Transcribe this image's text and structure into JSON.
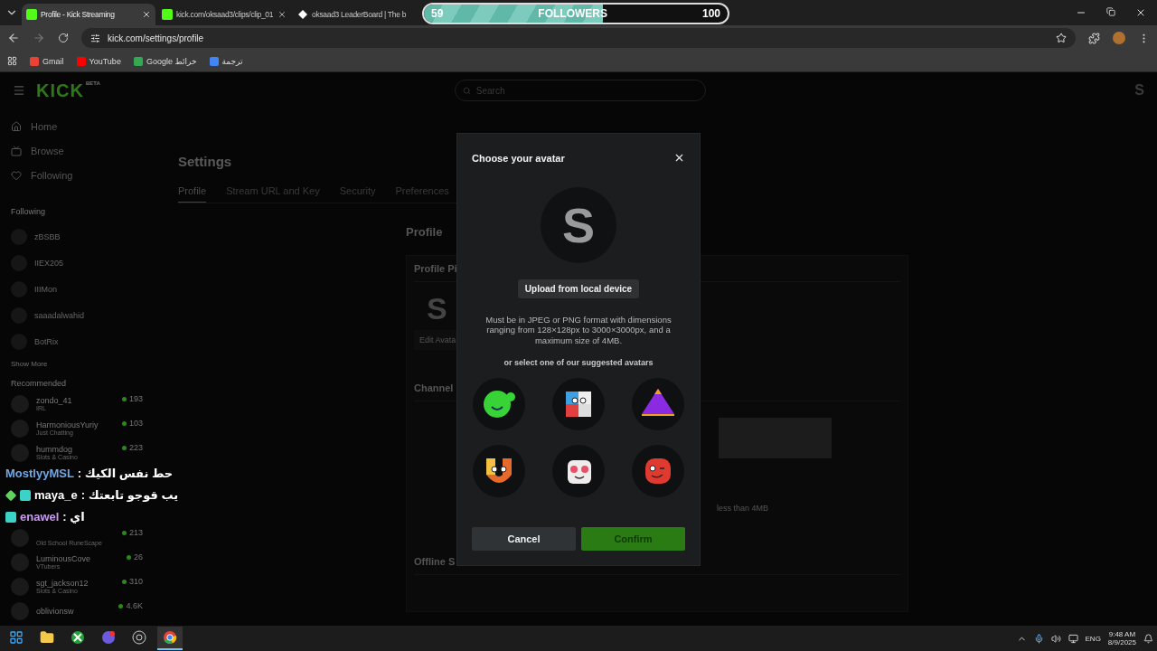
{
  "browser": {
    "tabs": [
      {
        "label": "Profile - Kick Streaming",
        "selected": true,
        "kind": "kick"
      },
      {
        "label": "kick.com/oksaad3/clips/clip_01",
        "selected": false,
        "kind": "kick"
      },
      {
        "label": "oksaad3 LeaderBoard | The b",
        "selected": false,
        "kind": "diamond"
      }
    ],
    "followers_widget": {
      "current": "59",
      "label": "FOLLOWERS",
      "goal": "100",
      "level": 0.59
    },
    "address": "kick.com/settings/profile",
    "bookmarks": [
      {
        "label": "Gmail",
        "kind": "gmail"
      },
      {
        "label": "YouTube",
        "kind": "youtube"
      },
      {
        "label": "Google خرائط",
        "kind": "maps"
      },
      {
        "label": "ترجمة",
        "kind": "translate"
      }
    ]
  },
  "header": {
    "logo": "KICK",
    "badge": "BETA",
    "search": {
      "placeholder": "Search"
    },
    "user_initial": "S"
  },
  "sidebar": {
    "nav": [
      {
        "label": "Home",
        "kind": "home"
      },
      {
        "label": "Browse",
        "kind": "browse"
      },
      {
        "label": "Following",
        "kind": "following"
      }
    ],
    "following_title": "Following",
    "following": [
      "zBSBB",
      "IIEX205",
      "IIIMon",
      "saaadalwahid",
      "BotRix"
    ],
    "show_more": "Show More",
    "recommended_title": "Recommended",
    "recommended": [
      {
        "name": "zondo_41",
        "category": "IRL",
        "viewers": "193"
      },
      {
        "name": "HarmoniousYuriy",
        "category": "Just Chatting",
        "viewers": "103"
      },
      {
        "name": "hummdog",
        "category": "Slots & Casino",
        "viewers": "223"
      },
      {
        "category": "Old School RuneScape",
        "viewers": "213"
      },
      {
        "name": "LuminousCove",
        "category": "VTubers",
        "viewers": "26"
      },
      {
        "name": "sgt_jackson12",
        "category": "Slots & Casino",
        "viewers": "310"
      },
      {
        "name": "oblivionsw",
        "viewers": "4.6K"
      }
    ]
  },
  "settings": {
    "title": "Settings",
    "tabs": [
      {
        "label": "Profile",
        "selected": true
      },
      {
        "label": "Stream URL and Key",
        "selected": false
      },
      {
        "label": "Security",
        "selected": false
      },
      {
        "label": "Preferences",
        "selected": false
      }
    ],
    "section_title": "Profile",
    "card_title": "Profile Pi",
    "avatar_initial": "S",
    "edit_button": "Edit Avata",
    "channel_title": "Channel",
    "banner_note": "less than 4MB",
    "offline_title": "Offline S"
  },
  "chat": [
    {
      "user": "MostlyyMSL",
      "message": ": حط نفس الكيك",
      "color": "#6fa8e6"
    },
    {
      "user": "maya_e",
      "message": ": يب قوجو تابعتك",
      "color": "#ffffff",
      "badges": [
        {
          "kind": "gem"
        },
        {
          "kind": "og"
        }
      ]
    },
    {
      "user": "enawel",
      "message": ": اي",
      "color": "#c99bf0",
      "badges": [
        {
          "kind": "og"
        }
      ]
    }
  ],
  "modal": {
    "title": "Choose your avatar",
    "initial": "S",
    "upload": "Upload from local device",
    "note": "Must be in JPEG or PNG format with dimensions ranging from 128×128px to 3000×3000px, and a maximum size of 4MB.",
    "divider": "or select one of our suggested avatars",
    "avatars": [
      {
        "kind": "green"
      },
      {
        "kind": "cube"
      },
      {
        "kind": "pyramid"
      },
      {
        "kind": "magnet"
      },
      {
        "kind": "mug"
      },
      {
        "kind": "red"
      }
    ],
    "cancel": "Cancel",
    "confirm": "Confirm"
  },
  "taskbar": {
    "apps": [
      {
        "kind": "start",
        "selected": false
      },
      {
        "kind": "files",
        "selected": false
      },
      {
        "kind": "xbox",
        "selected": false
      },
      {
        "kind": "chat",
        "selected": false
      },
      {
        "kind": "obs",
        "selected": false
      },
      {
        "kind": "chrome",
        "selected": true
      }
    ],
    "language": "ENG",
    "time": "9:48 AM",
    "date": "8/9/2025"
  }
}
